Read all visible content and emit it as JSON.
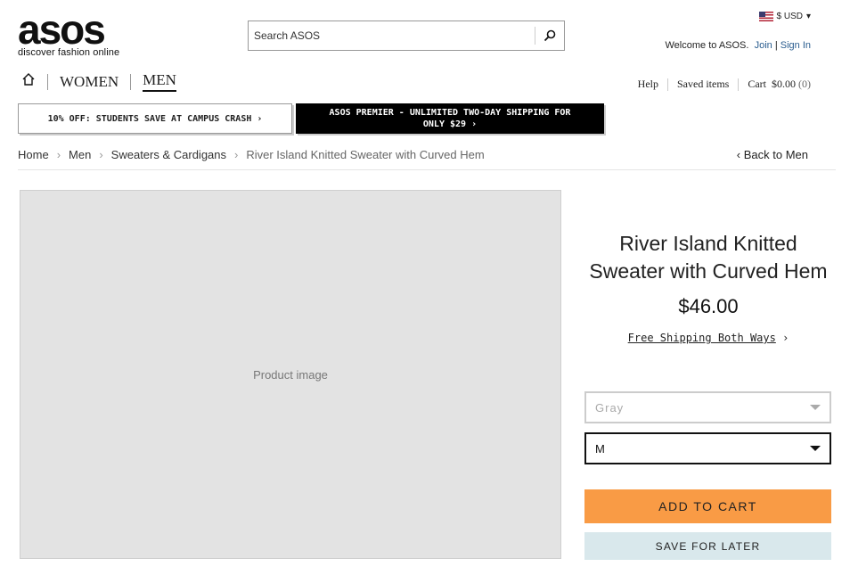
{
  "brand": {
    "wordmark": "asos",
    "tagline": "discover fashion online"
  },
  "search": {
    "placeholder": "Search ASOS",
    "icon": "search-icon"
  },
  "currency": {
    "label": "$ USD",
    "icon": "us-flag-icon"
  },
  "welcome": {
    "text": "Welcome to ASOS.",
    "join": "Join",
    "separator": "|",
    "signin": "Sign In"
  },
  "nav": {
    "home_icon": "home-icon",
    "women": "WOMEN",
    "men": "MEN"
  },
  "utility": {
    "help": "Help",
    "saved": "Saved items",
    "cart_label": "Cart",
    "cart_total": "$0.00",
    "cart_count": "(0)"
  },
  "promos": {
    "students": "10% OFF: STUDENTS SAVE AT CAMPUS CRASH ›",
    "premier_line1": "ASOS PREMIER - UNLIMITED TWO-DAY SHIPPING FOR",
    "premier_line2": "ONLY $29 ›"
  },
  "breadcrumb": {
    "items": [
      "Home",
      "Men",
      "Sweaters & Cardigans"
    ],
    "current": "River Island Knitted Sweater with Curved Hem"
  },
  "back_link": "‹  Back to Men",
  "product": {
    "title_line1": "River Island Knitted",
    "title_line2": "Sweater with Curved Hem",
    "price": "$46.00",
    "shipping": "Free Shipping Both Ways",
    "color_value": "Gray",
    "size_value": "M",
    "add_to_cart": "ADD TO CART",
    "save_for_later": "SAVE FOR LATER"
  },
  "colors": {
    "add_to_cart_bg": "#f99b45",
    "save_bg": "#d9e8ec"
  }
}
